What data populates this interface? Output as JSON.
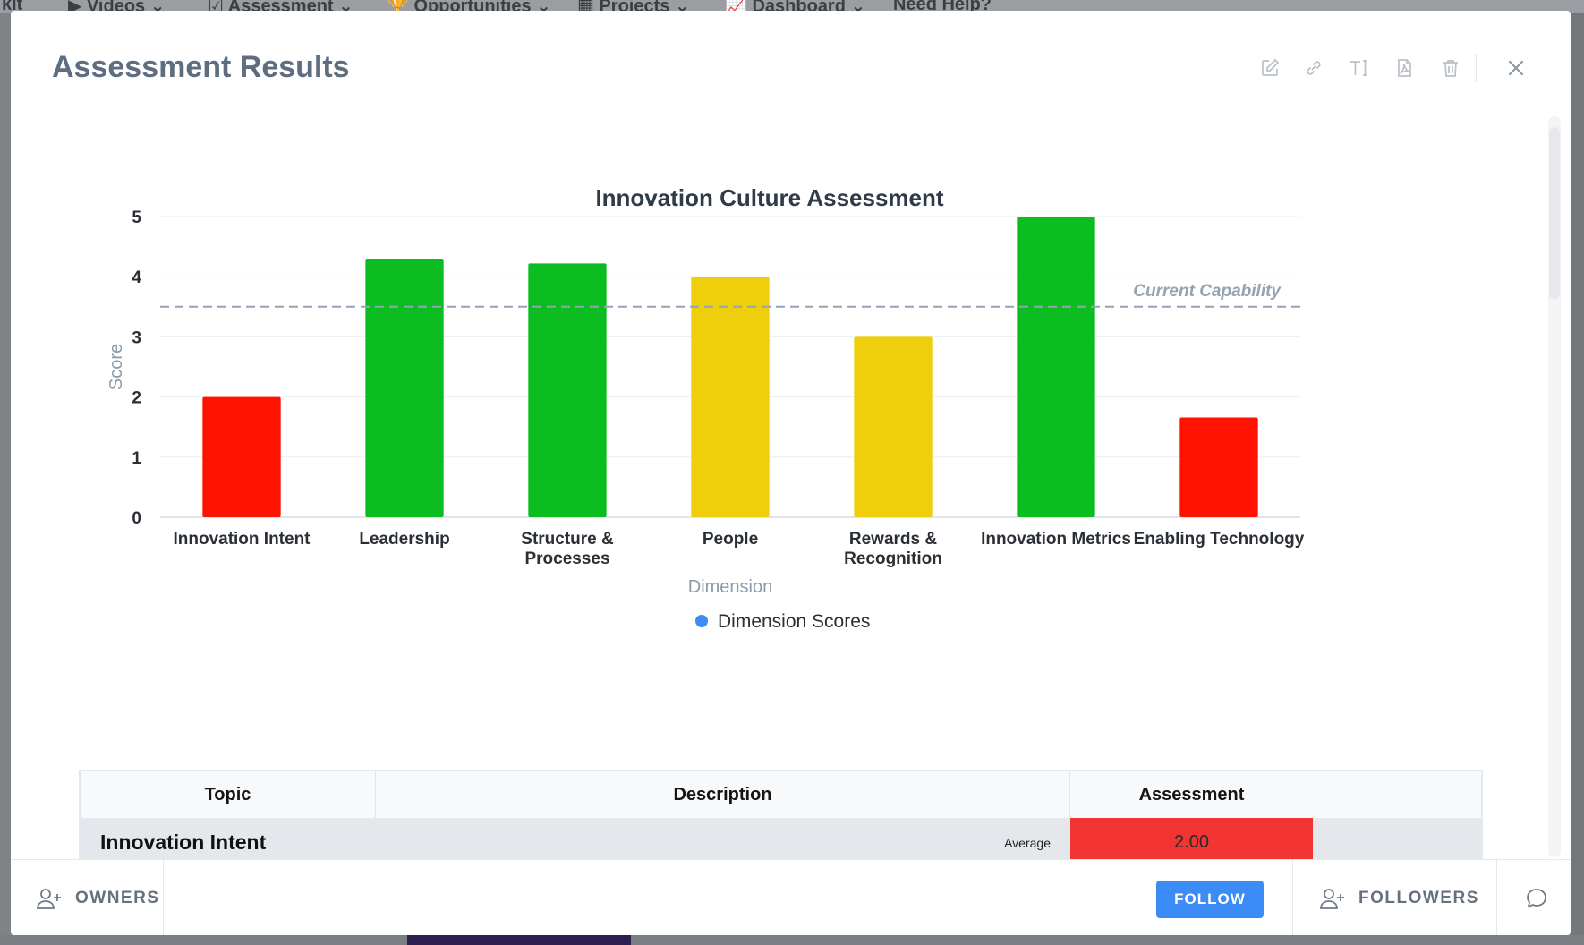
{
  "background_nav": {
    "items": [
      "kit",
      "Videos",
      "Assessment",
      "Opportunities",
      "Projects",
      "Dashboard",
      "Need Help?"
    ]
  },
  "modal": {
    "title": "Assessment Results",
    "toolbar": [
      {
        "name": "edit-icon"
      },
      {
        "name": "link-icon"
      },
      {
        "name": "text-format-icon"
      },
      {
        "name": "pdf-icon"
      },
      {
        "name": "trash-icon"
      }
    ],
    "close_icon": "close-icon"
  },
  "chart_data": {
    "type": "bar",
    "title": "Innovation Culture Assessment",
    "xlabel": "Dimension",
    "ylabel": "Score",
    "ylim": [
      0,
      5
    ],
    "yticks": [
      0,
      1,
      2,
      3,
      4,
      5
    ],
    "grid": true,
    "categories": [
      "Innovation Intent",
      "Leadership",
      "Structure & Processes",
      "People",
      "Rewards & Recognition",
      "Innovation Metrics",
      "Enabling Technology"
    ],
    "category_lines": [
      [
        "Innovation Intent"
      ],
      [
        "Leadership"
      ],
      [
        "Structure &",
        "Processes"
      ],
      [
        "People"
      ],
      [
        "Rewards &",
        "Recognition"
      ],
      [
        "Innovation Metrics"
      ],
      [
        "Enabling Technology"
      ]
    ],
    "series": [
      {
        "name": "Dimension Scores",
        "values": [
          2.0,
          4.3,
          4.22,
          4.0,
          3.0,
          5.0,
          1.66
        ]
      }
    ],
    "bar_colors": [
      "#ff1300",
      "#0cbd22",
      "#0cbd22",
      "#efcf0b",
      "#efcf0b",
      "#0cbd22",
      "#ff1300"
    ],
    "reference_line": {
      "label": "Current Capability",
      "value": 3.5,
      "color": "#94a3b3"
    },
    "legend": {
      "position": "bottom",
      "marker_color": "#3b8cf6"
    }
  },
  "table": {
    "headers": [
      "Topic",
      "Description",
      "Assessment"
    ],
    "rows": [
      {
        "topic": "Innovation Intent",
        "description": "",
        "average_label": "Average",
        "assessment": "2.00",
        "color": "#f23532"
      }
    ]
  },
  "footer": {
    "owners_label": "OWNERS",
    "follow_label": "FOLLOW",
    "followers_label": "FOLLOWERS"
  }
}
